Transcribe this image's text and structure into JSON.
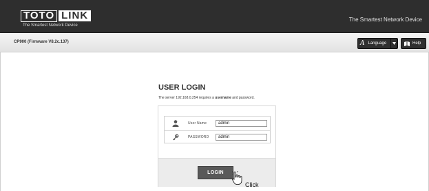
{
  "header": {
    "logo_left": "TOTO",
    "logo_right": "LINK",
    "logo_tagline": "The Smartest Network Device",
    "slogan": "The Smartest Network Device"
  },
  "toolbar": {
    "firmware": "CP900 (Firmware V8.2c.137)",
    "language_label": "Language",
    "language_icon": "A",
    "help_label": "Help"
  },
  "login": {
    "title": "USER LOGIN",
    "desc_prefix": "The server 192.168.0.254 requires a ",
    "desc_bold": "username",
    "desc_suffix": " and password.",
    "username_label": "User Name",
    "username_value": "admin",
    "password_label": "PASSWORD",
    "password_value": "admin",
    "button_label": "LOGIN"
  },
  "annotation": {
    "click_label": "Click"
  },
  "colors": {
    "header_bg": "#2e2e2e",
    "button_bg": "#595959",
    "panel_band": "#ececec"
  }
}
